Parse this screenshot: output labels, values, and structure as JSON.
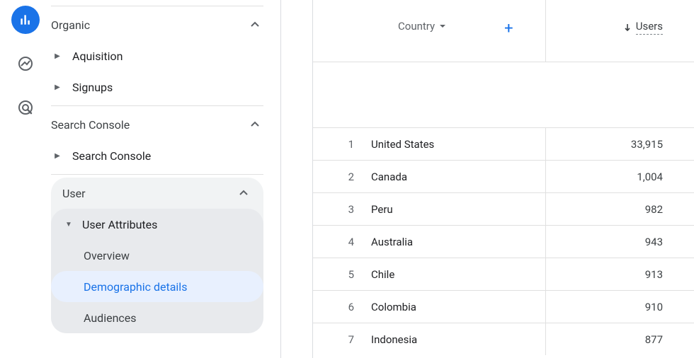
{
  "sidebar": {
    "organic": {
      "label": "Organic",
      "items": [
        "Aquisition",
        "Signups"
      ]
    },
    "search_console": {
      "label": "Search Console",
      "items": [
        "Search Console"
      ]
    },
    "user": {
      "label": "User",
      "attributes_label": "User Attributes",
      "leaves": [
        "Overview",
        "Demographic details",
        "Audiences"
      ],
      "active_index": 1
    }
  },
  "table": {
    "dimension_label": "Country",
    "metric_label": "Users",
    "rows": [
      {
        "idx": "1",
        "name": "United States",
        "value": "33,915"
      },
      {
        "idx": "2",
        "name": "Canada",
        "value": "1,004"
      },
      {
        "idx": "3",
        "name": "Peru",
        "value": "982"
      },
      {
        "idx": "4",
        "name": "Australia",
        "value": "943"
      },
      {
        "idx": "5",
        "name": "Chile",
        "value": "913"
      },
      {
        "idx": "6",
        "name": "Colombia",
        "value": "910"
      },
      {
        "idx": "7",
        "name": "Indonesia",
        "value": "877"
      }
    ]
  }
}
